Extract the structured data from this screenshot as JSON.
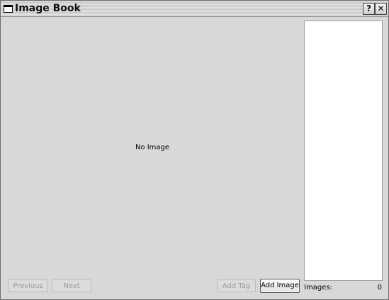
{
  "window": {
    "title": "Image Book",
    "help_glyph": "?",
    "close_glyph": "✕"
  },
  "viewer": {
    "placeholder": "No Image"
  },
  "buttons": {
    "previous": "Previous",
    "next": "Next",
    "add_tag": "Add Tag",
    "add_image": "Add Image"
  },
  "status": {
    "images_label": "Images:",
    "images_count": "0"
  }
}
